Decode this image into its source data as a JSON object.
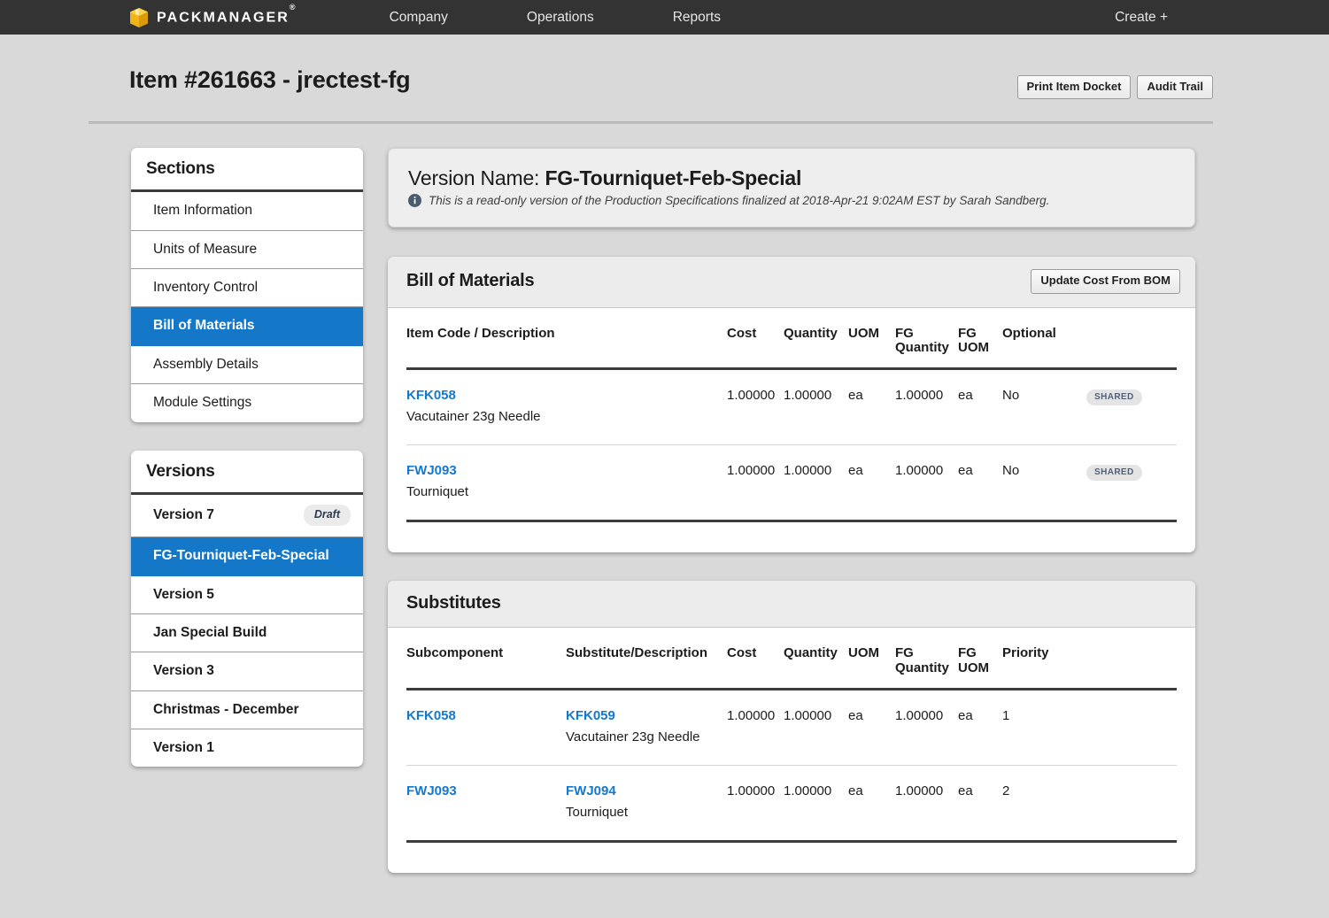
{
  "nav": {
    "brand": "PACKMANAGER",
    "brand_mark": "®",
    "logo_icon": "package-box-icon",
    "links": [
      "Company",
      "Operations",
      "Reports"
    ],
    "create_label": "Create +"
  },
  "header": {
    "title": "Item #261663 - jrectest-fg",
    "print_label": "Print Item Docket",
    "audit_label": "Audit Trail"
  },
  "sidebar": {
    "sections": {
      "title": "Sections",
      "items": [
        {
          "label": "Item Information",
          "active": false
        },
        {
          "label": "Units of Measure",
          "active": false
        },
        {
          "label": "Inventory Control",
          "active": false
        },
        {
          "label": "Bill of Materials",
          "active": true
        },
        {
          "label": "Assembly Details",
          "active": false
        },
        {
          "label": "Module Settings",
          "active": false
        }
      ]
    },
    "versions": {
      "title": "Versions",
      "items": [
        {
          "label": "Version 7",
          "badge": "Draft",
          "active": false
        },
        {
          "label": "FG-Tourniquet-Feb-Special",
          "badge": "",
          "active": true
        },
        {
          "label": "Version 5",
          "badge": "",
          "active": false
        },
        {
          "label": "Jan Special Build",
          "badge": "",
          "active": false
        },
        {
          "label": "Version 3",
          "badge": "",
          "active": false
        },
        {
          "label": "Christmas - December",
          "badge": "",
          "active": false
        },
        {
          "label": "Version 1",
          "badge": "",
          "active": false
        }
      ]
    }
  },
  "version_card": {
    "label": "Version Name:",
    "name": "FG-Tourniquet-Feb-Special",
    "info_icon": "info-circle-icon",
    "note": "This is a read-only version of the Production Specifications finalized at 2018-Apr-21 9:02AM EST by Sarah Sandberg."
  },
  "bom": {
    "title": "Bill of Materials",
    "update_button": "Update Cost From BOM",
    "columns": [
      "Item Code / Description",
      "Cost",
      "Quantity",
      "UOM",
      "FG Quantity",
      "FG UOM",
      "Optional",
      ""
    ],
    "rows": [
      {
        "code": "KFK058",
        "description": "Vacutainer 23g Needle",
        "cost": "1.00000",
        "quantity": "1.00000",
        "uom": "ea",
        "fg_quantity": "1.00000",
        "fg_uom": "ea",
        "optional": "No",
        "flag": "SHARED"
      },
      {
        "code": "FWJ093",
        "description": "Tourniquet",
        "cost": "1.00000",
        "quantity": "1.00000",
        "uom": "ea",
        "fg_quantity": "1.00000",
        "fg_uom": "ea",
        "optional": "No",
        "flag": "SHARED"
      }
    ]
  },
  "substitutes": {
    "title": "Substitutes",
    "columns": [
      "Subcomponent",
      "Substitute/Description",
      "Cost",
      "Quantity",
      "UOM",
      "FG Quantity",
      "FG UOM",
      "Priority"
    ],
    "rows": [
      {
        "subcomponent": "KFK058",
        "substitute": "KFK059",
        "description": "Vacutainer 23g Needle",
        "cost": "1.00000",
        "quantity": "1.00000",
        "uom": "ea",
        "fg_quantity": "1.00000",
        "fg_uom": "ea",
        "priority": "1"
      },
      {
        "subcomponent": "FWJ093",
        "substitute": "FWJ094",
        "description": "Tourniquet",
        "cost": "1.00000",
        "quantity": "1.00000",
        "uom": "ea",
        "fg_quantity": "1.00000",
        "fg_uom": "ea",
        "priority": "2"
      }
    ]
  },
  "colors": {
    "nav_bg": "#333333",
    "accent_blue": "#1577c8",
    "link_blue": "#1378cf",
    "page_bg": "#d9d9d9",
    "logo_gold": "#f2b518"
  }
}
